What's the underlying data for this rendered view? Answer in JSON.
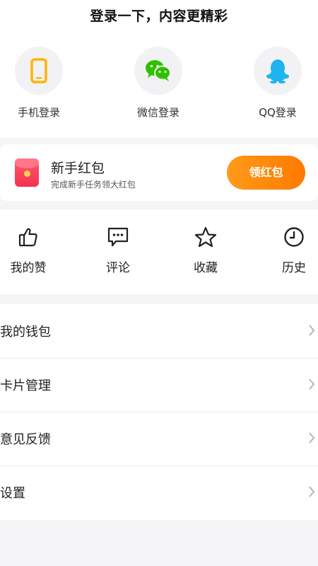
{
  "header": {
    "title": "登录一下，内容更精彩"
  },
  "login_options": [
    {
      "label": "手机登录",
      "icon": "phone-icon"
    },
    {
      "label": "微信登录",
      "icon": "wechat-icon"
    },
    {
      "label": "QQ登录",
      "icon": "qq-icon"
    }
  ],
  "red_packet": {
    "title": "新手红包",
    "subtitle": "完成新手任务领大红包",
    "button": "领红包"
  },
  "quick_actions": [
    {
      "label": "我的赞",
      "icon": "thumbs-up-icon"
    },
    {
      "label": "评论",
      "icon": "comment-icon"
    },
    {
      "label": "收藏",
      "icon": "star-icon"
    },
    {
      "label": "历史",
      "icon": "clock-icon"
    }
  ],
  "menu": [
    {
      "label": "我的钱包"
    },
    {
      "label": "卡片管理"
    },
    {
      "label": "意见反馈"
    },
    {
      "label": "设置"
    }
  ],
  "colors": {
    "accent_orange": "#ff8a00",
    "red_packet": "#f4314f",
    "wechat_green": "#2ec100",
    "qq_blue": "#1eb4f0",
    "phone_yellow": "#ffb400"
  }
}
